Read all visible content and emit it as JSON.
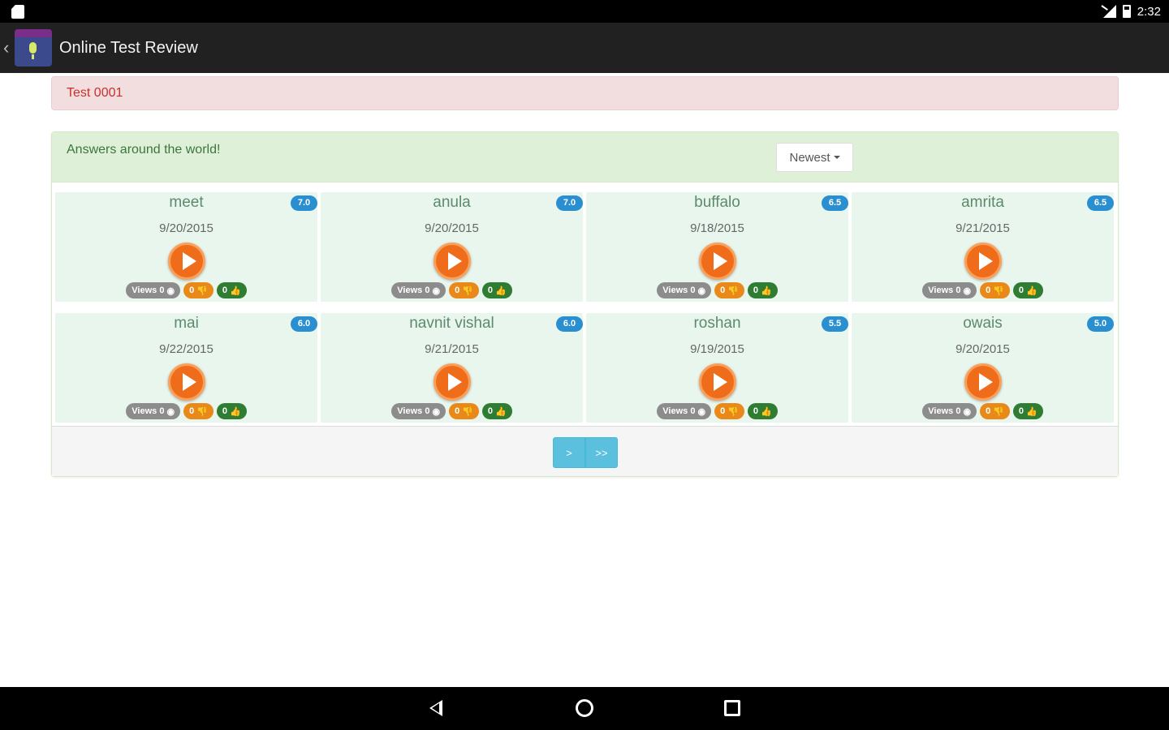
{
  "status_bar": {
    "time": "2:32"
  },
  "app_bar": {
    "back_glyph": "‹",
    "title": "Online Test Review",
    "icon": "microphone-icon"
  },
  "test_banner": {
    "label": "Test 0001"
  },
  "panel": {
    "title": "Answers around the world!",
    "sort_label": "Newest"
  },
  "answers": [
    {
      "name": "meet",
      "score": "7.0",
      "date": "9/20/2015",
      "views": "Views 0",
      "dislikes": "0",
      "likes": "0"
    },
    {
      "name": "anula",
      "score": "7.0",
      "date": "9/20/2015",
      "views": "Views 0",
      "dislikes": "0",
      "likes": "0"
    },
    {
      "name": "buffalo",
      "score": "6.5",
      "date": "9/18/2015",
      "views": "Views 0",
      "dislikes": "0",
      "likes": "0"
    },
    {
      "name": "amrita",
      "score": "6.5",
      "date": "9/21/2015",
      "views": "Views 0",
      "dislikes": "0",
      "likes": "0"
    },
    {
      "name": "mai",
      "score": "6.0",
      "date": "9/22/2015",
      "views": "Views 0",
      "dislikes": "0",
      "likes": "0"
    },
    {
      "name": "navnit vishal",
      "score": "6.0",
      "date": "9/21/2015",
      "views": "Views 0",
      "dislikes": "0",
      "likes": "0"
    },
    {
      "name": "roshan",
      "score": "5.5",
      "date": "9/19/2015",
      "views": "Views 0",
      "dislikes": "0",
      "likes": "0"
    },
    {
      "name": "owais",
      "score": "5.0",
      "date": "9/20/2015",
      "views": "Views 0",
      "dislikes": "0",
      "likes": "0"
    }
  ],
  "pager": {
    "next_label": ">",
    "last_label": ">>"
  },
  "nav_bar": {
    "icons": [
      "back-icon",
      "home-icon",
      "recents-icon"
    ]
  },
  "colors": {
    "accent": "#2a8fd0",
    "play": "#ef6c1a",
    "card_bg": "#e8f6ee",
    "banner_bg": "#f2dede"
  }
}
